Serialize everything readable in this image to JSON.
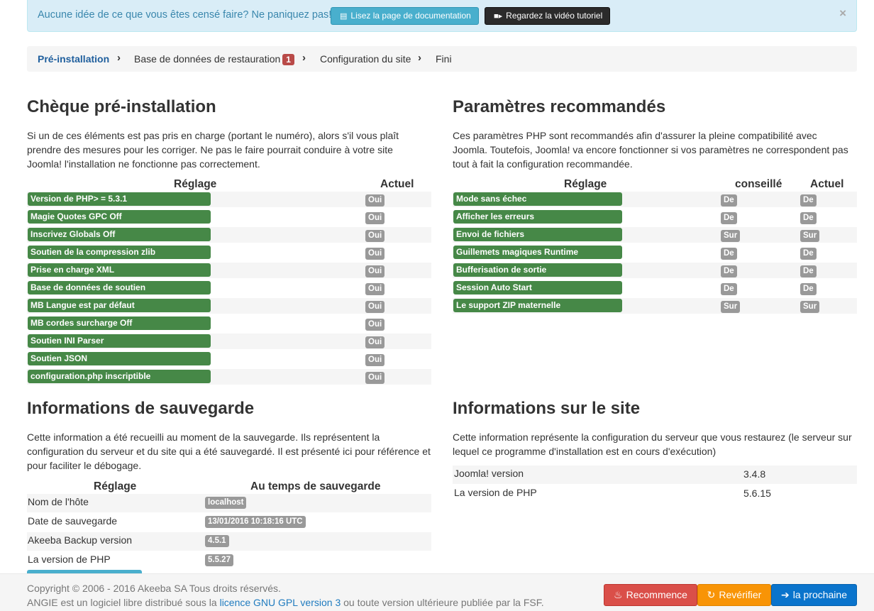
{
  "alert": {
    "text": "Aucune idée de ce que vous êtes censé faire? Ne paniquez pas!",
    "doc_button": "Lisez la page de documentation",
    "video_button": "Regardez la vidéo tutoriel",
    "close": "×"
  },
  "breadcrumb": {
    "steps": [
      "Pré-installation",
      "Base de données de restauration",
      "Configuration du site",
      "Fini"
    ],
    "badge": "1"
  },
  "precheck": {
    "title": "Chèque pré-installation",
    "description": "Si un de ces éléments est pas pris en charge (portant le numéro), alors s'il vous plaît prendre des mesures pour les corriger. Ne pas le faire pourrait conduire à votre site Joomla! l'installation ne fonctionne pas correctement.",
    "col_setting": "Réglage",
    "col_current": "Actuel",
    "rows": [
      {
        "label": "Version de PHP> = 5.3.1",
        "value": "Oui"
      },
      {
        "label": "Magie Quotes GPC Off",
        "value": "Oui"
      },
      {
        "label": "Inscrivez Globals Off",
        "value": "Oui"
      },
      {
        "label": "Soutien de la compression zlib",
        "value": "Oui"
      },
      {
        "label": "Prise en charge XML",
        "value": "Oui"
      },
      {
        "label": "Base de données de soutien",
        "value": "Oui"
      },
      {
        "label": "MB Langue est par défaut",
        "value": "Oui"
      },
      {
        "label": "MB cordes surcharge Off",
        "value": "Oui"
      },
      {
        "label": "Soutien INI Parser",
        "value": "Oui"
      },
      {
        "label": "Soutien JSON",
        "value": "Oui"
      },
      {
        "label": "configuration.php inscriptible",
        "value": "Oui"
      }
    ]
  },
  "recommended": {
    "title": "Paramètres recommandés",
    "description": "Ces paramètres PHP sont recommandés afin d'assurer la pleine compatibilité avec Joomla. Toutefois, Joomla! va encore fonctionner si vos paramètres ne correspondent pas tout à fait la configuration recommandée.",
    "col_setting": "Réglage",
    "col_advised": "conseillé",
    "col_current": "Actuel",
    "rows": [
      {
        "label": "Mode sans échec",
        "advised": "De",
        "current": "De"
      },
      {
        "label": "Afficher les erreurs",
        "advised": "De",
        "current": "De"
      },
      {
        "label": "Envoi de fichiers",
        "advised": "Sur",
        "current": "Sur"
      },
      {
        "label": "Guillemets magiques Runtime",
        "advised": "De",
        "current": "De"
      },
      {
        "label": "Bufferisation de sortie",
        "advised": "De",
        "current": "De"
      },
      {
        "label": "Session Auto Start",
        "advised": "De",
        "current": "De"
      },
      {
        "label": "Le support ZIP maternelle",
        "advised": "Sur",
        "current": "Sur"
      }
    ]
  },
  "backup": {
    "title": "Informations de sauvegarde",
    "description": "Cette information a été recueilli au moment de la sauvegarde. Ils représentent la configuration du serveur et du site qui a été sauvegardé. Il est présenté ici pour référence et pour faciliter le débogage.",
    "col_setting": "Réglage",
    "col_backup": "Au temps de sauvegarde",
    "rows": [
      {
        "label": "Nom de l'hôte",
        "value": "localhost"
      },
      {
        "label": "Date de sauvegarde",
        "value": "13/01/2016 10:18:16 UTC"
      },
      {
        "label": "Akeeba Backup version",
        "value": "4.5.1"
      },
      {
        "label": "La version de PHP",
        "value": "5.5.27"
      }
    ]
  },
  "site": {
    "title": "Informations sur le site",
    "description": "Cette information représente la configuration du serveur que vous restaurez (le serveur sur lequel ce programme d'installation est en cours d'exécution)",
    "rows": [
      {
        "label": "Joomla! version",
        "value": "3.4.8"
      },
      {
        "label": "La version de PHP",
        "value": "5.6.15"
      }
    ]
  },
  "footer": {
    "copyright": "Copyright © 2006 - 2016 Akeeba SA Tous droits réservés.",
    "license_prefix": "ANGIE est un logiciel libre distribué sous la ",
    "license_link": "licence GNU GPL version 3",
    "license_suffix": " ou toute version ultérieure publiée par la FSF.",
    "restart_button": "Recommence",
    "recheck_button": "Revérifier",
    "next_button": "la prochaine"
  },
  "colors": {
    "success": "#468847",
    "info": "#49afcd",
    "danger": "#da4f49",
    "warning": "#f89406",
    "primary": "#0a74cc"
  }
}
